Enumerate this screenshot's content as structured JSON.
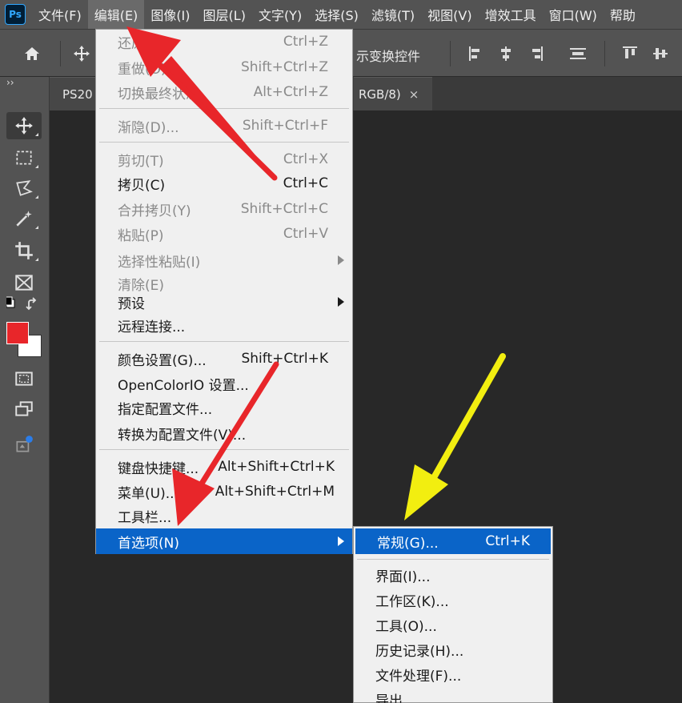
{
  "app": {
    "logo_text": "Ps"
  },
  "menubar": {
    "items": [
      "文件(F)",
      "编辑(E)",
      "图像(I)",
      "图层(L)",
      "文字(Y)",
      "选择(S)",
      "滤镜(T)",
      "视图(V)",
      "增效工具",
      "窗口(W)",
      "帮助"
    ]
  },
  "options_bar": {
    "show_transform_label": "示变换控件"
  },
  "document_tab": {
    "left_text": "PS20",
    "right_text": "RGB/8)",
    "close_glyph": "×"
  },
  "toolbar": {
    "collapse_glyph": "››",
    "foreground_color": "#e8262a",
    "background_color": "#ffffff"
  },
  "edit_menu": {
    "items": [
      {
        "label": "还原(O)",
        "shortcut": "Ctrl+Z"
      },
      {
        "label": "重做(O)",
        "shortcut": "Shift+Ctrl+Z"
      },
      {
        "label": "切换最终状态",
        "shortcut": "Alt+Ctrl+Z"
      },
      {
        "label": "渐隐(D)...",
        "shortcut": "Shift+Ctrl+F"
      },
      {
        "label": "剪切(T)",
        "shortcut": "Ctrl+X"
      },
      {
        "label": "拷贝(C)",
        "shortcut": "Ctrl+C"
      },
      {
        "label": "合并拷贝(Y)",
        "shortcut": "Shift+Ctrl+C"
      },
      {
        "label": "粘贴(P)",
        "shortcut": "Ctrl+V"
      },
      {
        "label": "选择性粘贴(I)",
        "shortcut": ""
      },
      {
        "label": "清除(E)",
        "shortcut": ""
      },
      {
        "label": "预设",
        "shortcut": ""
      },
      {
        "label": "远程连接...",
        "shortcut": ""
      },
      {
        "label": "颜色设置(G)...",
        "shortcut": "Shift+Ctrl+K"
      },
      {
        "label": "OpenColorIO 设置...",
        "shortcut": ""
      },
      {
        "label": "指定配置文件...",
        "shortcut": ""
      },
      {
        "label": "转换为配置文件(V)...",
        "shortcut": ""
      },
      {
        "label": "键盘快捷键...",
        "shortcut": "Alt+Shift+Ctrl+K"
      },
      {
        "label": "菜单(U)...",
        "shortcut": "Alt+Shift+Ctrl+M"
      },
      {
        "label": "工具栏...",
        "shortcut": ""
      },
      {
        "label": "首选项(N)",
        "shortcut": ""
      }
    ]
  },
  "preferences_submenu": {
    "items": [
      {
        "label": "常规(G)...",
        "shortcut": "Ctrl+K"
      },
      {
        "label": "界面(I)...",
        "shortcut": ""
      },
      {
        "label": "工作区(K)...",
        "shortcut": ""
      },
      {
        "label": "工具(O)...",
        "shortcut": ""
      },
      {
        "label": "历史记录(H)...",
        "shortcut": ""
      },
      {
        "label": "文件处理(F)...",
        "shortcut": ""
      },
      {
        "label": "导出...",
        "shortcut": ""
      }
    ]
  },
  "annotation_colors": {
    "red_arrow": "#e8262a",
    "yellow_arrow": "#f2ee10"
  }
}
